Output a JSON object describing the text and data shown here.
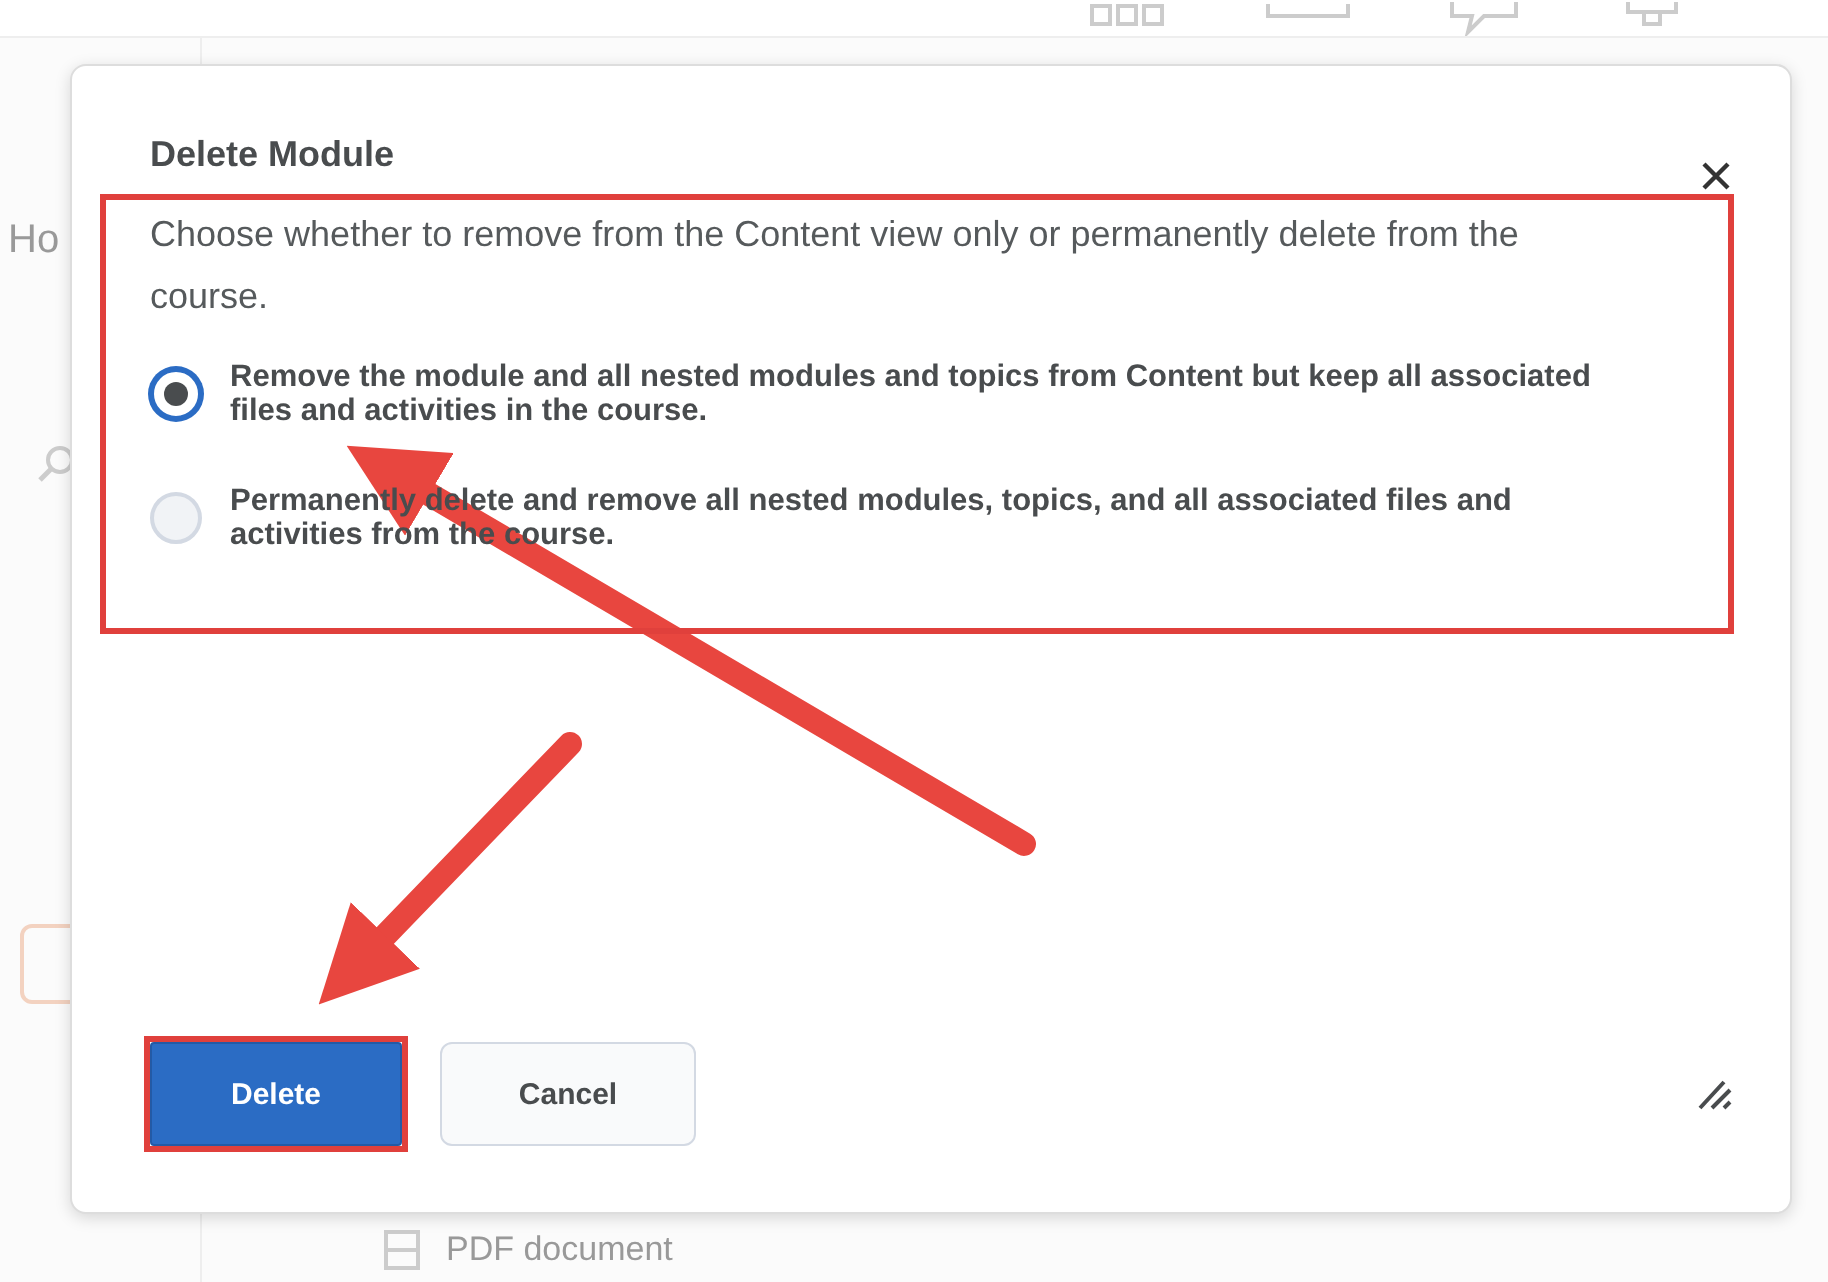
{
  "background": {
    "nav_label": "Ho",
    "list_item": "PDF document"
  },
  "dialog": {
    "title": "Delete Module",
    "description": "Choose whether to remove from the Content view only or permanently delete from the course.",
    "options": [
      {
        "label": "Remove the module and all nested modules and topics from Content but keep all associated files and activities in the course.",
        "selected": true
      },
      {
        "label": "Permanently delete and remove all nested modules, topics, and all associated files and activities from the course.",
        "selected": false
      }
    ],
    "buttons": [
      {
        "label": "Delete",
        "kind": "primary"
      },
      {
        "label": "Cancel",
        "kind": "secondary"
      }
    ]
  }
}
